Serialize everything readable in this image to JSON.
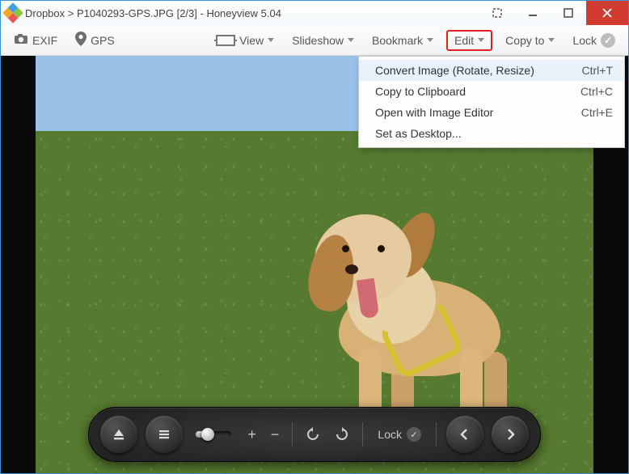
{
  "titlebar": {
    "path_prefix": "Dropbox",
    "separator": ">",
    "filename": "P1040293-GPS.JPG",
    "counter": "[2/3]",
    "app": "Honeyview 5.04"
  },
  "toolbar": {
    "exif": "EXIF",
    "gps": "GPS",
    "view": "View",
    "slideshow": "Slideshow",
    "bookmark": "Bookmark",
    "edit": "Edit",
    "copyto": "Copy to",
    "lock": "Lock"
  },
  "edit_menu": {
    "items": [
      {
        "label": "Convert Image (Rotate, Resize)",
        "shortcut": "Ctrl+T"
      },
      {
        "label": "Copy to Clipboard",
        "shortcut": "Ctrl+C"
      },
      {
        "label": "Open with Image Editor",
        "shortcut": "Ctrl+E"
      },
      {
        "label": "Set as Desktop...",
        "shortcut": ""
      }
    ]
  },
  "controlbar": {
    "lock_label": "Lock",
    "zoom_plus": "+",
    "zoom_minus": "−"
  }
}
